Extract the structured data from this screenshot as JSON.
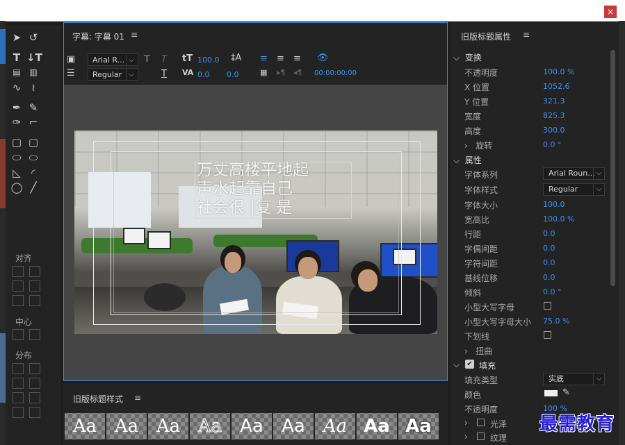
{
  "caption_panel": {
    "title": "字幕: 字幕 01",
    "menu_icon": "≡",
    "font_family": "Arial R...",
    "font_style": "Regular",
    "font_size": "100.0",
    "tracking": "0.0",
    "kerning": "0.0",
    "timecode": "00:00:00:00",
    "caption_lines": [
      "万丈高楼平地起",
      "声水起靠自己",
      "社会很 |复 是 "
    ]
  },
  "tools_panel": {
    "align_label": "对齐",
    "center_label": "中心",
    "distribute_label": "分布"
  },
  "styles_panel": {
    "title": "旧版标题样式",
    "menu_icon": "≡",
    "swatch_label": "Aa"
  },
  "props_panel": {
    "title": "旧版标题属性",
    "menu_icon": "≡",
    "transform": {
      "label": "变换",
      "opacity_label": "不透明度",
      "opacity_value": "100.0 %",
      "x_label": "X 位置",
      "x_value": "1052.6",
      "y_label": "Y 位置",
      "y_value": "321.3",
      "width_label": "宽度",
      "width_value": "825.3",
      "height_label": "高度",
      "height_value": "300.0",
      "rotation_label": "旋转",
      "rotation_value": "0.0 °"
    },
    "properties": {
      "label": "属性",
      "font_family_label": "字体系列",
      "font_family_value": "Arial Roun...",
      "font_style_label": "字体样式",
      "font_style_value": "Regular",
      "font_size_label": "字体大小",
      "font_size_value": "100.0",
      "aspect_label": "宽高比",
      "aspect_value": "100.0 %",
      "leading_label": "行距",
      "leading_value": "0.0",
      "kerning_label": "字偶间距",
      "kerning_value": "0.0",
      "tracking_label": "字符间距",
      "tracking_value": "0.0",
      "baseline_label": "基线位移",
      "baseline_value": "0.0",
      "slant_label": "倾斜",
      "slant_value": "0.0 °",
      "smallcaps_label": "小型大写字母",
      "smallcaps_size_label": "小型大写字母大小",
      "smallcaps_size_value": "75.0 %",
      "underline_label": "下划线",
      "distort_label": "扭曲"
    },
    "fill": {
      "label": "填充",
      "type_label": "填充类型",
      "type_value": "实底",
      "color_label": "颜色",
      "opacity_label": "不透明度",
      "opacity_value": "100 %",
      "sheen_label": "光泽",
      "texture_label": "纹理"
    }
  },
  "watermark": "最需教育"
}
